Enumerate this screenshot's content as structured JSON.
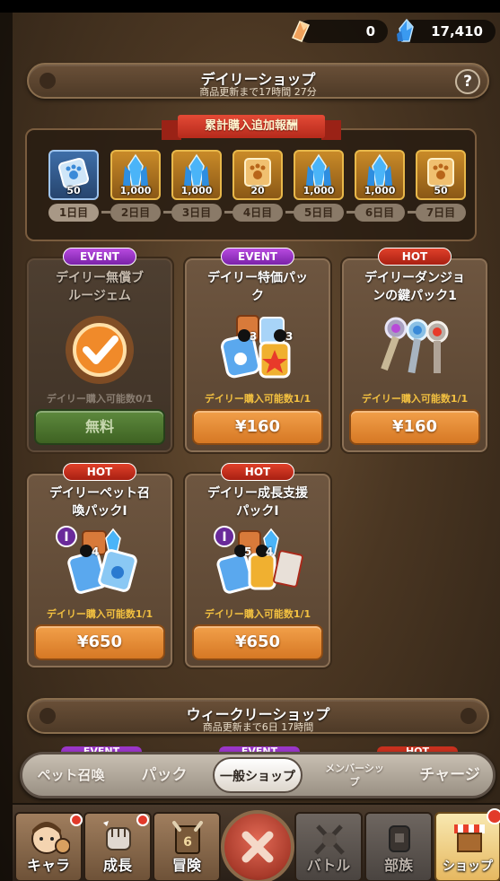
{
  "currency": {
    "energy": "0",
    "gems": "17,410"
  },
  "daily_shop": {
    "title": "デイリーショップ",
    "refresh": "商品更新まで17時間 27分",
    "help": "?"
  },
  "cumulative": {
    "title": "累計購入追加報酬",
    "days": [
      {
        "label": "1日目",
        "amount": "50",
        "icon": "paw-ticket-icon"
      },
      {
        "label": "2日目",
        "amount": "1,000",
        "icon": "gem-crystal-icon"
      },
      {
        "label": "3日目",
        "amount": "1,000",
        "icon": "gem-crystal-icon"
      },
      {
        "label": "4日目",
        "amount": "20",
        "icon": "paw-scroll-icon"
      },
      {
        "label": "5日目",
        "amount": "1,000",
        "icon": "gem-crystal-icon"
      },
      {
        "label": "6日目",
        "amount": "1,000",
        "icon": "gem-crystal-icon"
      },
      {
        "label": "7日目",
        "amount": "50",
        "icon": "paw-scroll-icon"
      }
    ]
  },
  "cards": [
    {
      "tag": "EVENT",
      "name_line1": "デイリー無償ブ",
      "name_line2": "ルージェム",
      "limit": "デイリー購入可能数0/1",
      "price": "無料"
    },
    {
      "tag": "EVENT",
      "name_line1": "デイリー特価パッ",
      "name_line2": "ク",
      "limit": "デイリー購入可能数1/1",
      "price": "¥160",
      "qty_a": "3",
      "qty_b": "3"
    },
    {
      "tag": "HOT",
      "name_line1": "デイリーダンジョ",
      "name_line2": "ンの鍵パック1",
      "limit": "デイリー購入可能数1/1",
      "price": "¥160"
    },
    {
      "tag": "HOT",
      "name_line1": "デイリーペット召",
      "name_line2": "喚パックI",
      "limit": "デイリー購入可能数1/1",
      "price": "¥650",
      "qty_a": "4"
    },
    {
      "tag": "HOT",
      "name_line1": "デイリー成長支援",
      "name_line2": "パックI",
      "limit": "デイリー購入可能数1/1",
      "price": "¥650",
      "qty_a": "5",
      "qty_b": "4"
    }
  ],
  "weekly_shop": {
    "title": "ウィークリーショップ",
    "refresh": "商品更新まで6日 17時間"
  },
  "peek_tags": [
    "EVENT",
    "EVENT",
    "HOT"
  ],
  "tabs": {
    "pet": "ペット召喚",
    "pack": "パック",
    "general": "一般ショップ",
    "member_line1": "メンバーシッ",
    "member_line2": "プ",
    "charge": "チャージ"
  },
  "nav": {
    "chara": "キャラ",
    "growth": "成長",
    "adventure": "冒険",
    "battle": "バトル",
    "clan": "部族",
    "shop": "ショップ"
  },
  "colors": {
    "price_button": "#e08a34",
    "free_button": "#4e763a",
    "event_tag": "#9a36c8",
    "hot_tag": "#c8301e",
    "limit_text": "#f2c040"
  }
}
